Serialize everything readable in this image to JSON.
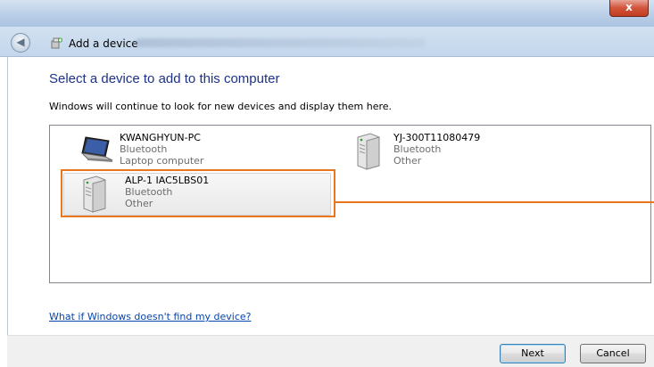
{
  "window": {
    "close_label": "x",
    "title": "Add a device"
  },
  "heading": "Select a device to add to this computer",
  "instructions": "Windows will continue to look for new devices and display them here.",
  "devices": [
    {
      "name": "KWANGHYUN-PC",
      "connection": "Bluetooth",
      "category": "Laptop computer",
      "icon": "laptop-icon"
    },
    {
      "name": "YJ-300T11080479",
      "connection": "Bluetooth",
      "category": "Other",
      "icon": "generic-device-icon"
    },
    {
      "name": "ALP-1 IAC5LBS01",
      "connection": "Bluetooth",
      "category": "Other",
      "icon": "generic-device-icon",
      "selected": true
    }
  ],
  "help_link": "What if Windows doesn't find my device?",
  "buttons": {
    "next": "Next",
    "cancel": "Cancel"
  },
  "colors": {
    "heading": "#1e3287",
    "highlight": "#e8771f",
    "link": "#0645ad"
  }
}
